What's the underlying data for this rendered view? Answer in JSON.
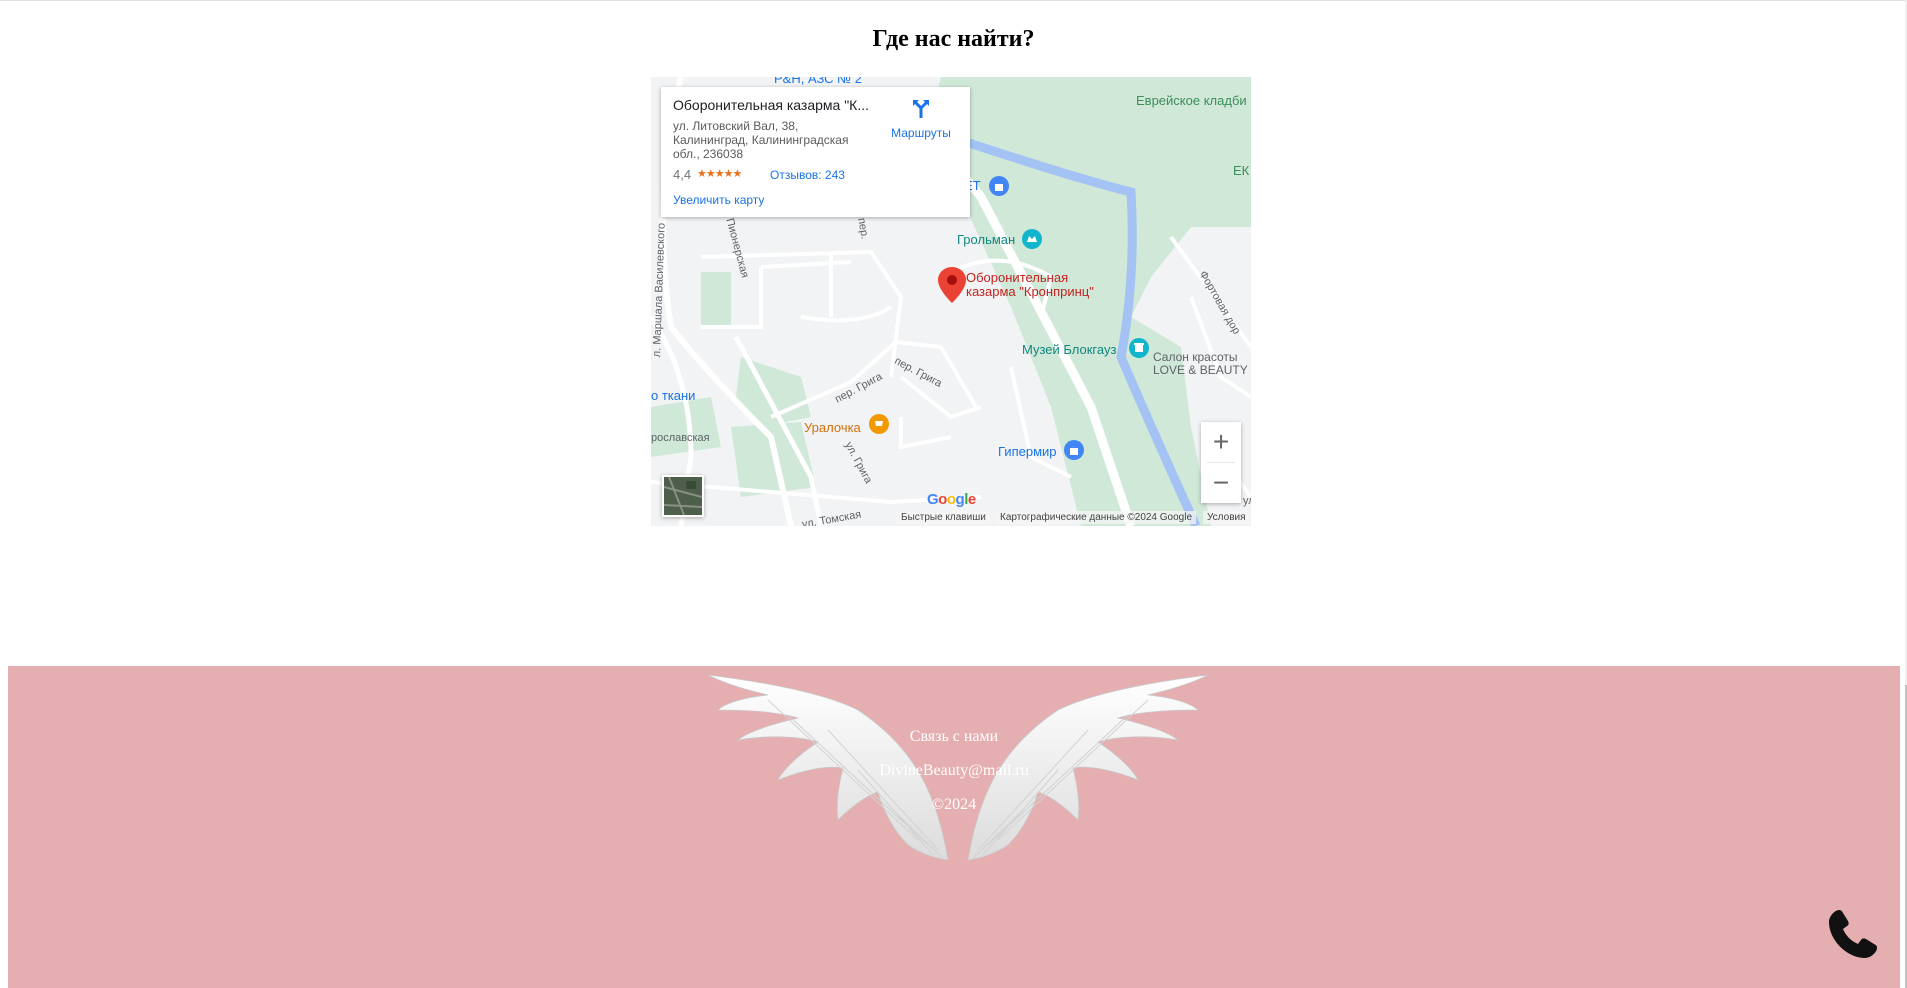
{
  "section": {
    "title": "Где нас найти?"
  },
  "map": {
    "place_name": "Оборонительная казарма \"К...",
    "address": "ул. Литовский Вал, 38, Калининград, Калининградская обл., 236038",
    "rating": "4,4",
    "stars": "★★★★★",
    "reviews_label": "Отзывов: 243",
    "enlarge_label": "Увеличить карту",
    "directions_label": "Маршруты",
    "pois": {
      "cemetery": "Еврейское кладби",
      "ek": "ЕК",
      "et": "ЕТ",
      "grolman": "Грольман",
      "marker_line1": "Оборонительная",
      "marker_line2": "казарма \"Кронпринц\"",
      "museum": "Музей Блокгауз",
      "salon_line1": "Салон красоты",
      "salon_line2": "LOVE & BEAUTY",
      "tkani": "о ткани",
      "uralochka": "Уралочка",
      "gipermir": "Гипермир",
      "top_cut": "P&H, АЗС № 2"
    },
    "streets": {
      "vasilevskogo": "л. Маршала Василевского",
      "pionerskaya": "Пионерская",
      "per_top": "пер.",
      "griga1": "пер. Грига",
      "griga2": "пер. Грига",
      "griga3": "ул. Грига",
      "fortovaya": "Фортовая дор",
      "yaroslavskaya": "рославская",
      "tomskaya": "ул. Томская",
      "ul_right": "ул"
    },
    "zoom_in": "+",
    "zoom_out": "−",
    "google": "Google",
    "shortcuts": "Быстрые клавиши",
    "map_data": "Картографические данные ©2024 Google",
    "terms": "Условия",
    "colors": {
      "river": "#a4c2f4",
      "park": "#cfe8d8",
      "land": "#f1f3f4",
      "road": "#ffffff",
      "marker": "#ea4335"
    }
  },
  "footer": {
    "contact_label": "Связь с нами",
    "email": "DivineBeauty@mail.ru",
    "copyright": "©2024",
    "background": "#e5aeb0"
  },
  "icons": {
    "phone": "phone-icon",
    "wings": "angel-wings-icon"
  }
}
